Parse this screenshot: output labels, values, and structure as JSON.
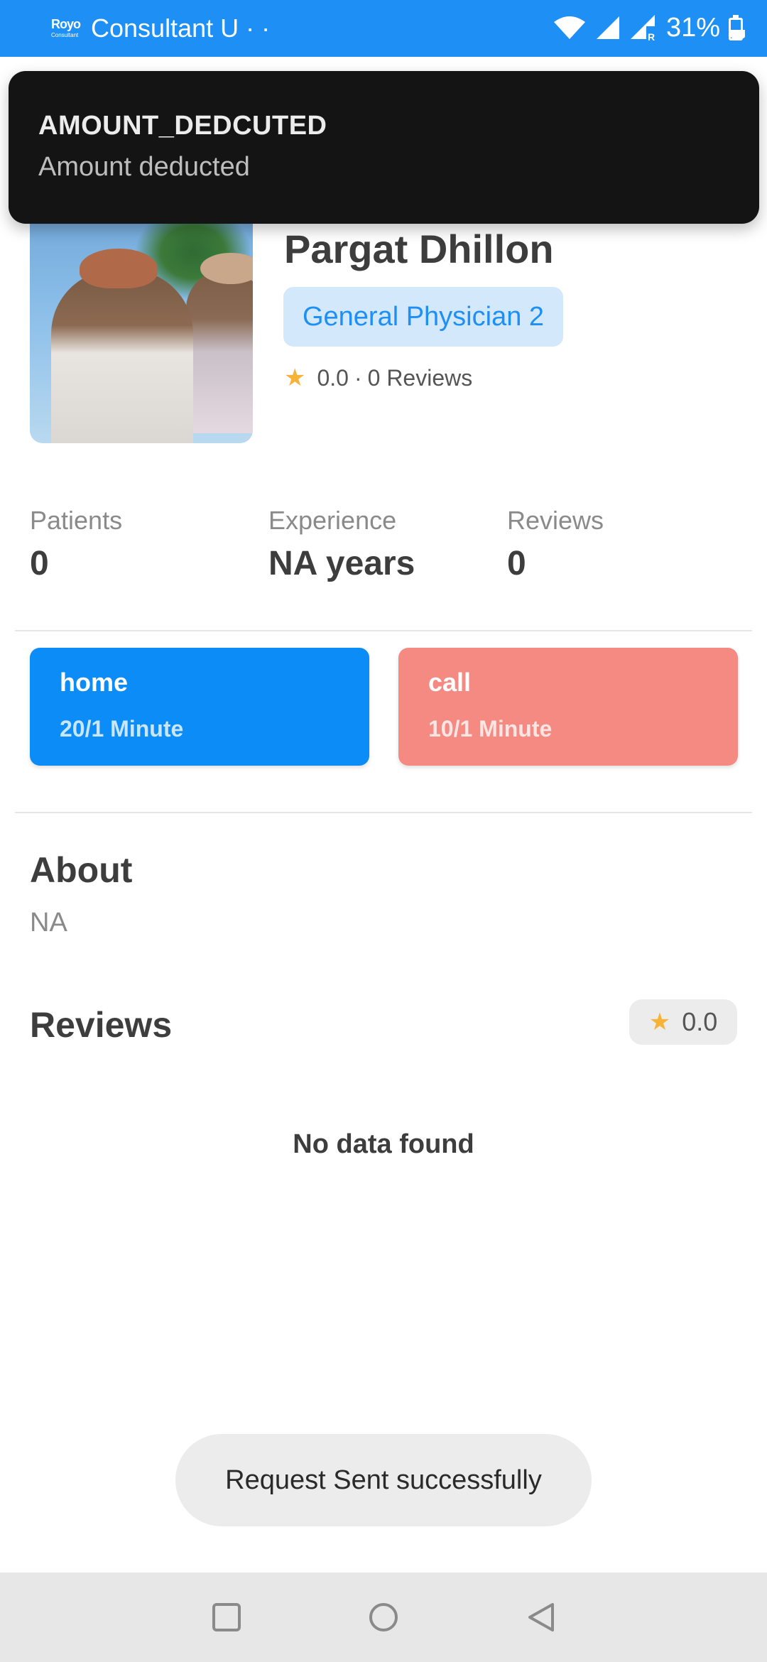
{
  "status_bar": {
    "app_logo_text": "Royo",
    "app_logo_sub": "Consultant",
    "app_title": "Consultant U · ·",
    "battery_percent": "31%",
    "icons": [
      "wifi-icon",
      "signal-icon",
      "signal-roaming-icon",
      "battery-icon"
    ]
  },
  "notification": {
    "title": "AMOUNT_DEDCUTED",
    "body": "Amount deducted"
  },
  "profile": {
    "name": "Pargat Dhillon",
    "specialty": "General Physician 2",
    "rating": "0.0",
    "separator": "·",
    "reviews_text": "0 Reviews"
  },
  "stats": {
    "patients_label": "Patients",
    "patients_value": "0",
    "experience_label": "Experience",
    "experience_value": "NA years",
    "reviews_label": "Reviews",
    "reviews_value": "0"
  },
  "services": [
    {
      "title": "home",
      "price": "20/1 Minute",
      "color": "#0b8cf7"
    },
    {
      "title": "call",
      "price": "10/1 Minute",
      "color": "#f48a82"
    }
  ],
  "about": {
    "heading": "About",
    "text": "NA"
  },
  "reviews": {
    "heading": "Reviews",
    "rating": "0.0",
    "empty_text": "No data found"
  },
  "toast": {
    "text": "Request Sent successfully"
  },
  "colors": {
    "accent": "#1e8ff4",
    "star": "#f6b338",
    "chip_bg": "#d3e9fb"
  }
}
